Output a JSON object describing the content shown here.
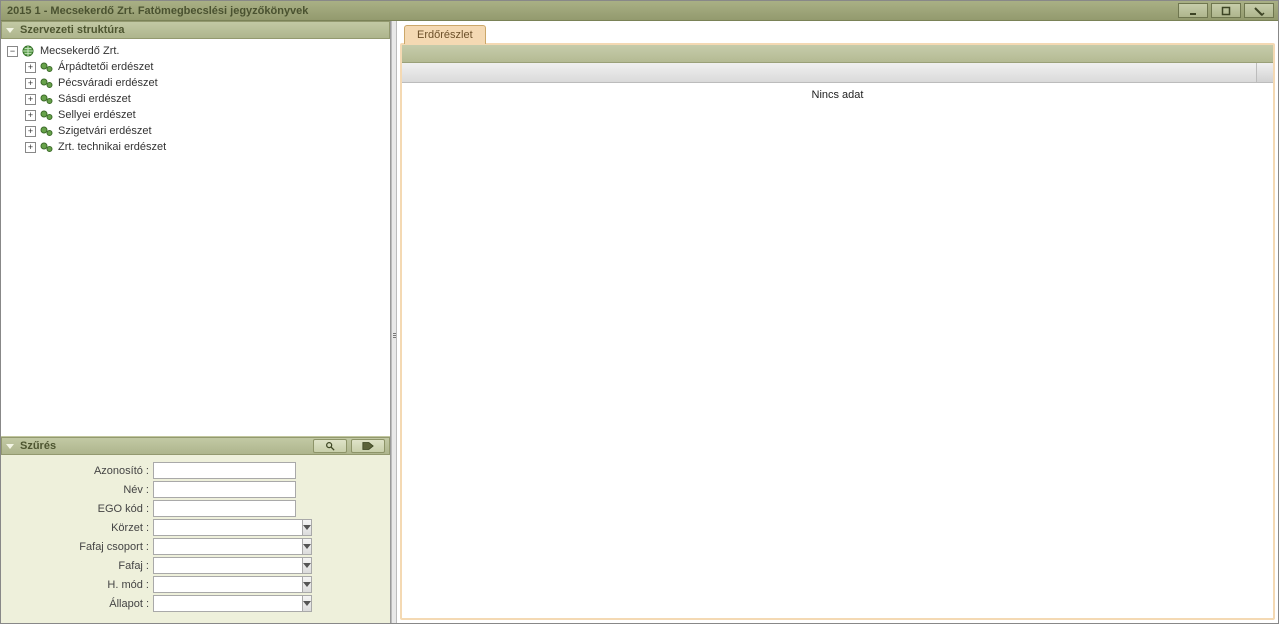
{
  "titlebar": {
    "title": "2015 1 - Mecsekerdő Zrt. Fatömegbecslési jegyzőkönyvek"
  },
  "sidebar": {
    "structure_title": "Szervezeti struktúra",
    "root": {
      "label": "Mecsekerdő Zrt.",
      "children": [
        {
          "label": "Árpádtetői erdészet"
        },
        {
          "label": "Pécsváradi erdészet"
        },
        {
          "label": "Sásdi erdészet"
        },
        {
          "label": "Sellyei erdészet"
        },
        {
          "label": "Szigetvári erdészet"
        },
        {
          "label": "Zrt. technikai erdészet"
        }
      ]
    }
  },
  "filter": {
    "title": "Szűrés",
    "fields": {
      "azonosito": {
        "label": "Azonosító :",
        "value": ""
      },
      "nev": {
        "label": "Név :",
        "value": ""
      },
      "ego_kod": {
        "label": "EGO kód :",
        "value": ""
      },
      "korzet": {
        "label": "Körzet :",
        "value": ""
      },
      "fafaj_csoport": {
        "label": "Fafaj csoport :",
        "value": ""
      },
      "fafaj": {
        "label": "Fafaj :",
        "value": ""
      },
      "h_mod": {
        "label": "H. mód :",
        "value": ""
      },
      "allapot": {
        "label": "Állapot :",
        "value": ""
      }
    }
  },
  "main": {
    "tab_label": "Erdőrészlet",
    "empty_text": "Nincs adat"
  }
}
